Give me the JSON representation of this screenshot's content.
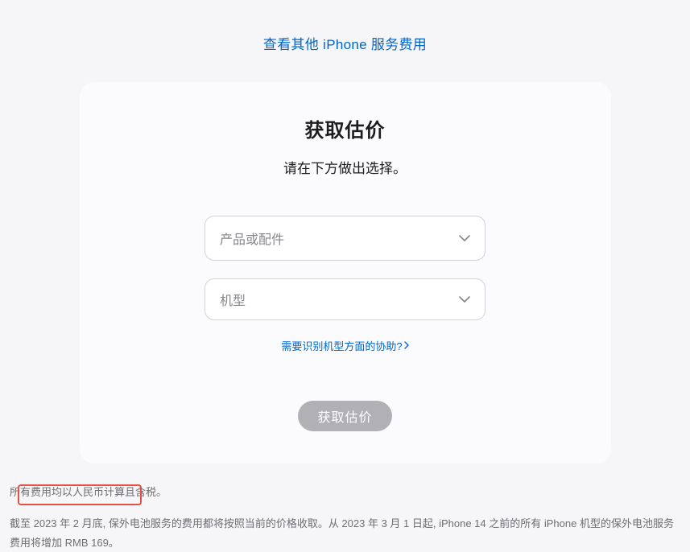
{
  "topLink": "查看其他 iPhone 服务费用",
  "card": {
    "title": "获取估价",
    "subtitle": "请在下方做出选择。",
    "select1": "产品或配件",
    "select2": "机型",
    "helpText": "需要识别机型方面的协助?",
    "submitBtn": "获取估价"
  },
  "disclaimer": {
    "line1": "所有费用均以人民币计算且含税。",
    "line2": "截至 2023 年 2 月底, 保外电池服务的费用都将按照当前的价格收取。从 2023 年 3 月 1 日起, iPhone 14 之前的所有 iPhone 机型的保外电池服务费用将增加 RMB 169。"
  }
}
